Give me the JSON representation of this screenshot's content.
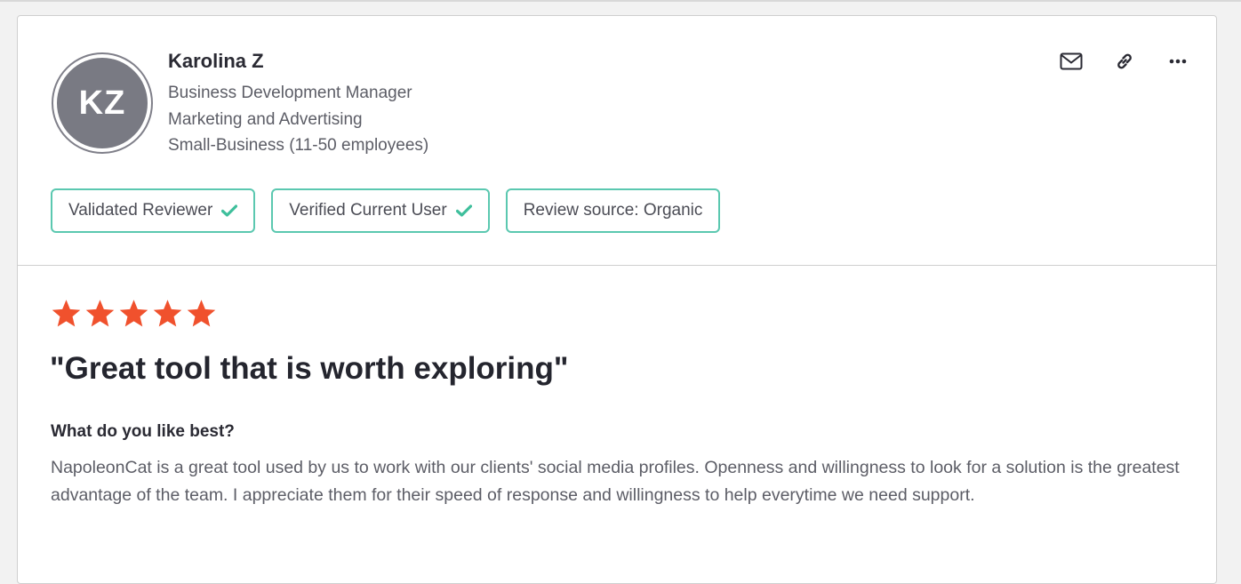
{
  "reviewer": {
    "initials": "KZ",
    "name": "Karolina Z",
    "title": "Business Development Manager",
    "industry": "Marketing and Advertising",
    "company_size": "Small-Business (11-50 employees)"
  },
  "actions": [
    {
      "icon": "mail-icon"
    },
    {
      "icon": "link-icon"
    },
    {
      "icon": "more-options-icon"
    }
  ],
  "badges": {
    "validated": "Validated Reviewer",
    "verified": "Verified Current User",
    "source": "Review source: Organic"
  },
  "colors": {
    "accent_teal": "#5bc8b0",
    "star_orange": "#f0512d",
    "avatar_gray": "#797a83"
  },
  "review": {
    "rating": 5,
    "max_rating": 5,
    "title": "\"Great tool that is worth exploring\"",
    "question": "What do you like best?",
    "answer": "NapoleonCat is a great tool used by us to work with our clients' social media profiles. Openness and willingness to look for a solution is the greatest advantage of the team. I appreciate them for their speed of response and willingness to help everytime we need support."
  }
}
